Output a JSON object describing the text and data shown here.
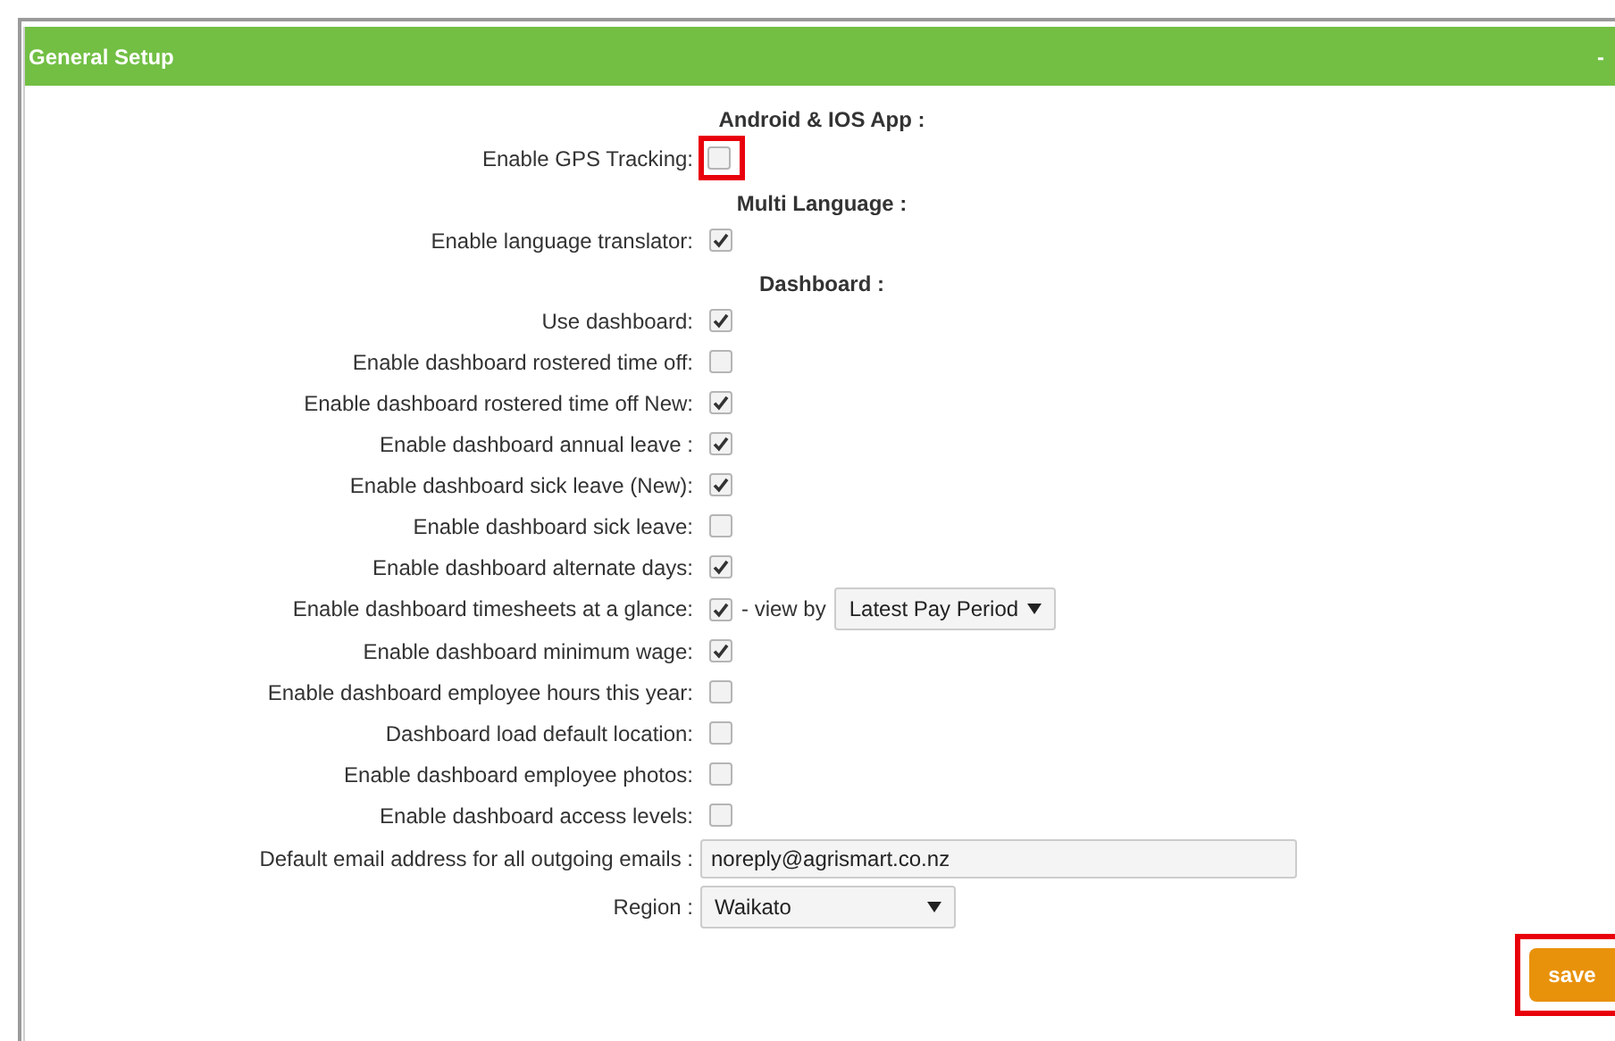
{
  "panel": {
    "title": "General Setup",
    "collapse_label": "-"
  },
  "sections": [
    {
      "title": "Android & IOS App :",
      "settings": [
        {
          "kind": "checkbox",
          "label": "Enable GPS Tracking:",
          "checked": false,
          "highlighted": true
        }
      ]
    },
    {
      "title": "Multi Language :",
      "settings": [
        {
          "kind": "checkbox",
          "label": "Enable language translator:",
          "checked": true,
          "highlighted": false
        }
      ]
    },
    {
      "title": "Dashboard :",
      "settings": [
        {
          "kind": "checkbox",
          "label": "Use dashboard:",
          "checked": true,
          "highlighted": false
        },
        {
          "kind": "checkbox",
          "label": "Enable dashboard rostered time off:",
          "checked": false,
          "highlighted": false
        },
        {
          "kind": "checkbox",
          "label": "Enable dashboard rostered time off New:",
          "checked": true,
          "highlighted": false
        },
        {
          "kind": "checkbox",
          "label": "Enable dashboard annual leave :",
          "checked": true,
          "highlighted": false
        },
        {
          "kind": "checkbox",
          "label": "Enable dashboard sick leave (New):",
          "checked": true,
          "highlighted": false
        },
        {
          "kind": "checkbox",
          "label": "Enable dashboard sick leave:",
          "checked": false,
          "highlighted": false
        },
        {
          "kind": "checkbox",
          "label": "Enable dashboard alternate days:",
          "checked": true,
          "highlighted": false
        },
        {
          "kind": "checkbox",
          "label": "Enable dashboard timesheets at a glance:",
          "checked": true,
          "highlighted": false,
          "view_by": {
            "label": "- view by",
            "value": "Latest Pay Period"
          }
        },
        {
          "kind": "checkbox",
          "label": "Enable dashboard minimum wage:",
          "checked": true,
          "highlighted": false
        },
        {
          "kind": "checkbox",
          "label": "Enable dashboard employee hours this year:",
          "checked": false,
          "highlighted": false
        },
        {
          "kind": "checkbox",
          "label": "Dashboard load default location:",
          "checked": false,
          "highlighted": false
        },
        {
          "kind": "checkbox",
          "label": "Enable dashboard employee photos:",
          "checked": false,
          "highlighted": false
        },
        {
          "kind": "checkbox",
          "label": "Enable dashboard access levels:",
          "checked": false,
          "highlighted": false
        },
        {
          "kind": "text",
          "label": "Default email address for all outgoing emails :",
          "value": "noreply@agrismart.co.nz"
        },
        {
          "kind": "select",
          "label": "Region :",
          "value": "Waikato"
        }
      ]
    }
  ],
  "save_button": {
    "label": "save",
    "highlighted": true
  }
}
